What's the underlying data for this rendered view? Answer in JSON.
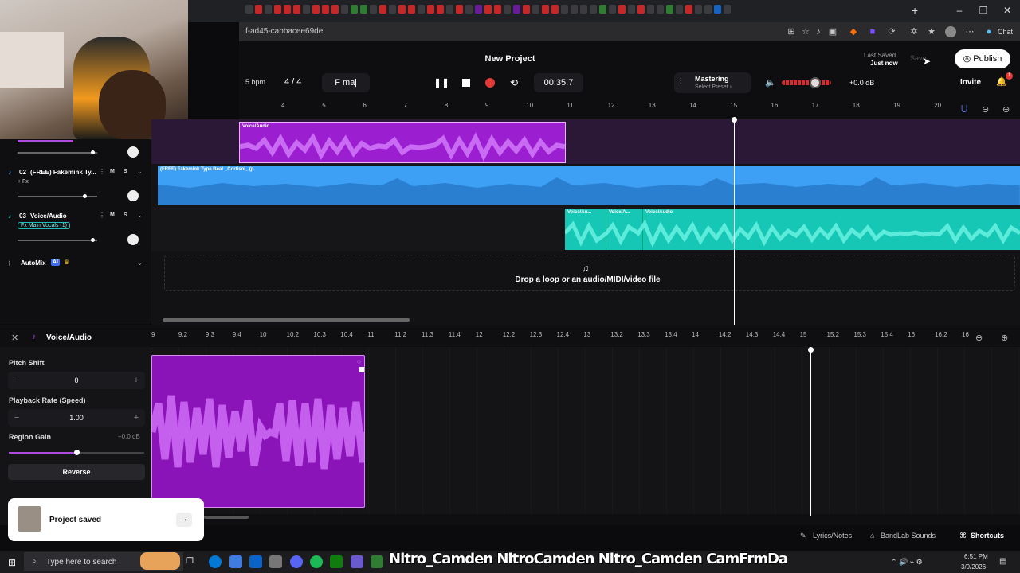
{
  "browser": {
    "url": "f-ad45-cabbacee69de",
    "chat_label": "Chat"
  },
  "app": {
    "project_title": "New Project",
    "bpm_label": "5  bpm",
    "time_signature": "4 / 4",
    "key": "F maj",
    "time": "00:35.7",
    "mastering_title": "Mastering",
    "mastering_preset": "Select Preset  ›",
    "volume_db": "+0.0 dB",
    "last_saved_label": "Last Saved",
    "last_saved_value": "Just now",
    "save_label": "Save",
    "publish_label": "Publish",
    "invite_label": "Invite",
    "notification_count": "1",
    "accent_record": "#e53935"
  },
  "ruler": [
    "4",
    "5",
    "6",
    "7",
    "8",
    "9",
    "10",
    "11",
    "12",
    "13",
    "14",
    "15",
    "16",
    "17",
    "18",
    "19",
    "20"
  ],
  "tracks": [
    {
      "number": "",
      "name": "",
      "clip_label": "Voice/Audio",
      "color": "#9b1fd0"
    },
    {
      "number": "02",
      "name": "(FREE) Fakemink Ty...",
      "fx": "+ Fx",
      "clip_label": "(FREE) Fakemink Type Beat _Cortisol_ (p",
      "color": "#3da0f5"
    },
    {
      "number": "03",
      "name": "Voice/Audio",
      "fx": "Fx Main Vocals (1)",
      "clip_labels": [
        "Voice/Au...",
        "Voice/A...",
        "Voice/Audio"
      ],
      "color": "#17d2c0"
    }
  ],
  "automix": {
    "label": "AutoMix",
    "badge": "AI"
  },
  "drop_zone": "Drop a loop or an audio/MIDI/video file",
  "editor": {
    "title": "Voice/Audio",
    "pitch_shift_label": "Pitch Shift",
    "pitch_shift_value": "0",
    "playback_rate_label": "Playback Rate (Speed)",
    "playback_rate_value": "1.00",
    "region_gain_label": "Region Gain",
    "region_gain_db": "+0.0 dB",
    "region_gain_level": 0.5,
    "reverse_label": "Reverse",
    "ruler": [
      "9",
      "9.2",
      "9.3",
      "9.4",
      "10",
      "10.2",
      "10.3",
      "10.4",
      "11",
      "11.2",
      "11.3",
      "11.4",
      "12",
      "12.2",
      "12.3",
      "12.4",
      "13",
      "13.2",
      "13.3",
      "13.4",
      "14",
      "14.2",
      "14.3",
      "14.4",
      "15",
      "15.2",
      "15.3",
      "15.4",
      "16",
      "16.2",
      "16"
    ]
  },
  "bottom": {
    "lyrics": "Lyrics/Notes",
    "sounds": "BandLab Sounds",
    "shortcuts": "Shortcuts"
  },
  "toast": {
    "text": "Project saved"
  },
  "taskbar": {
    "search_placeholder": "Type here to search",
    "overlay": "Nitro_Camden  NitroCamden  Nitro_Camden  CamFrmDaLou",
    "time": "6:51 PM",
    "date": "3/9/2026"
  }
}
